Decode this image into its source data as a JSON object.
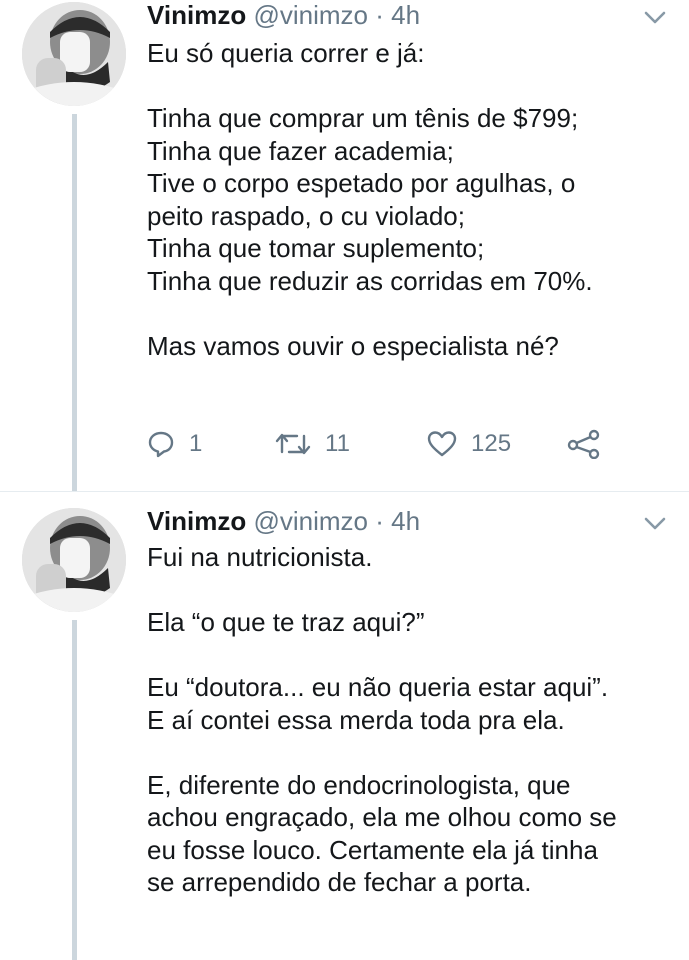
{
  "tweets": [
    {
      "author": {
        "name": "Vinimzo",
        "handle": "@vinimzo",
        "separator": "·",
        "time": "4h",
        "avatar_icon": "user-avatar-photo"
      },
      "body": {
        "lines": [
          "Eu só queria correr e já:",
          "",
          "Tinha que comprar um tênis de $799;",
          "Tinha que fazer academia;",
          "Tive o corpo espetado por agulhas, o",
          "peito raspado, o cu violado;",
          "Tinha que tomar suplemento;",
          "Tinha que reduzir as corridas em 70%.",
          "",
          "Mas vamos ouvir o especialista né?"
        ]
      },
      "actions": {
        "reply_count": "1",
        "retweet_count": "11",
        "like_count": "125",
        "reply_icon": "reply-icon",
        "retweet_icon": "retweet-icon",
        "like_icon": "heart-icon",
        "share_icon": "share-icon"
      }
    },
    {
      "author": {
        "name": "Vinimzo",
        "handle": "@vinimzo",
        "separator": "·",
        "time": "4h",
        "avatar_icon": "user-avatar-photo"
      },
      "body": {
        "lines": [
          "Fui na nutricionista.",
          "",
          "Ela “o que te traz aqui?”",
          "",
          "Eu “doutora... eu não queria estar aqui”.",
          "E aí contei essa merda toda pra ela.",
          "",
          "E, diferente do endocrinologista, que",
          "achou engraçado, ela me olhou como se",
          "eu fosse louco. Certamente ela já tinha",
          "se arrependido de fechar a porta."
        ]
      }
    }
  ],
  "colors": {
    "text": "#14171a",
    "muted": "#657786",
    "thread_line": "#ccd6dd",
    "divider": "#e6ecf0"
  }
}
